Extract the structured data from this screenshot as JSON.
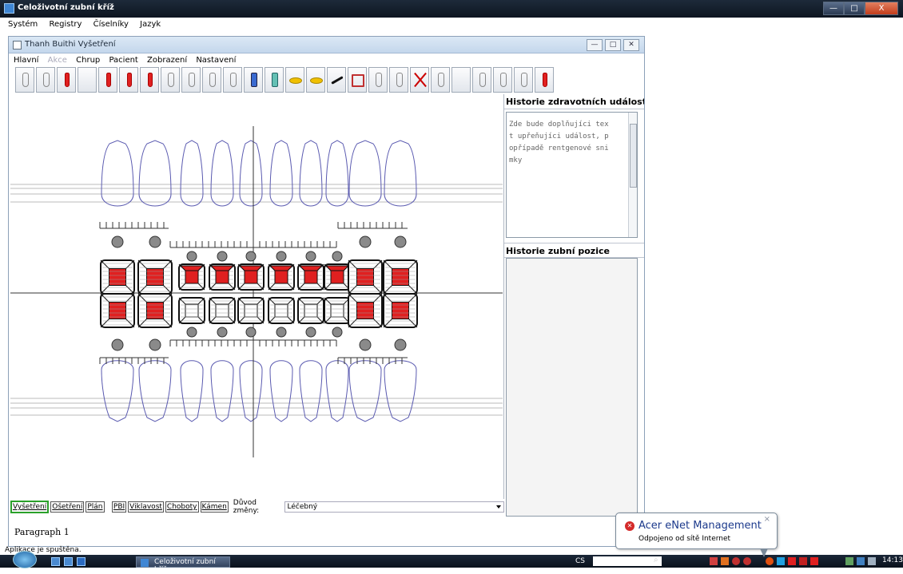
{
  "app": {
    "title": "Celoživotní zubní kříž",
    "controls": {
      "minimize": "—",
      "maximize": "□",
      "close": "X"
    }
  },
  "menu": [
    "Systém",
    "Registry",
    "Číselníky",
    "Jazyk"
  ],
  "window": {
    "title": "Thanh Buithi Vyšetření",
    "controls": {
      "minimize": "—",
      "maximize": "□",
      "close": "✕"
    },
    "menu": [
      {
        "label": "Hlavní",
        "enabled": true
      },
      {
        "label": "Akce",
        "enabled": false
      },
      {
        "label": "Chrup",
        "enabled": true
      },
      {
        "label": "Pacient",
        "enabled": true
      },
      {
        "label": "Zobrazení",
        "enabled": true
      },
      {
        "label": "Nastavení",
        "enabled": true
      }
    ]
  },
  "toolbar": {
    "tools": [
      "tooth-gray",
      "tooth-outline",
      "tooth-red-tip",
      "empty",
      "tooth-base-red",
      "arrows-red",
      "root-red",
      "root-black",
      "root-dark",
      "root-outline",
      "tooth-green",
      "bridge-blue",
      "bridge-teal",
      "pill-yellow",
      "pill-yellow-small",
      "line-black",
      "box-red",
      "tooth-outline",
      "tooth-outline",
      "cross-red",
      "tooth-outline",
      "empty",
      "tooth-green",
      "tooth-plus",
      "tooth-plus",
      "tooth-red-small"
    ]
  },
  "dental_chart": {
    "upper_red_marks": [
      1,
      1,
      1,
      1,
      1,
      1,
      1,
      1,
      1,
      1
    ],
    "upper_red_type": [
      "center",
      "center",
      "top",
      "top",
      "top",
      "top",
      "top",
      "top",
      "center",
      "center"
    ],
    "lower_red_type": [
      "center",
      "center",
      "none",
      "none",
      "none",
      "none",
      "none",
      "none",
      "center",
      "center"
    ]
  },
  "right_panel": {
    "events_title": "Historie zdravotních událostí",
    "events_text": [
      "Zde bude doplňujíci tex",
      "t upřeňujíci událost, p",
      "opřípadě rentgenové sni",
      "mky"
    ],
    "position_title": "Historie zubní pozice"
  },
  "tabs": [
    {
      "label": "Vyšetření",
      "active": true
    },
    {
      "label": "Ošetření",
      "active": false
    },
    {
      "label": "Plán",
      "active": false
    },
    {
      "label": "PBI",
      "active": false
    },
    {
      "label": "Viklavost",
      "active": false
    },
    {
      "label": "Choboty",
      "active": false
    },
    {
      "label": "Kámen",
      "active": false
    }
  ],
  "reason": {
    "label": "Důvod změny:",
    "value": "Léčebný"
  },
  "paragraph": "Paragraph 1",
  "status": "Aplikace je spuštěna.",
  "taskbar": {
    "task_label": "Celoživotní zubní kříž",
    "language": "CS",
    "clock": "14:13"
  },
  "notification": {
    "title": "Acer eNet Management",
    "message": "Odpojeno od sítě Internet",
    "close": "×"
  },
  "colors": {
    "mark": "#e02020",
    "tooth_line": "#5a5ab0",
    "grid": "#333333"
  }
}
